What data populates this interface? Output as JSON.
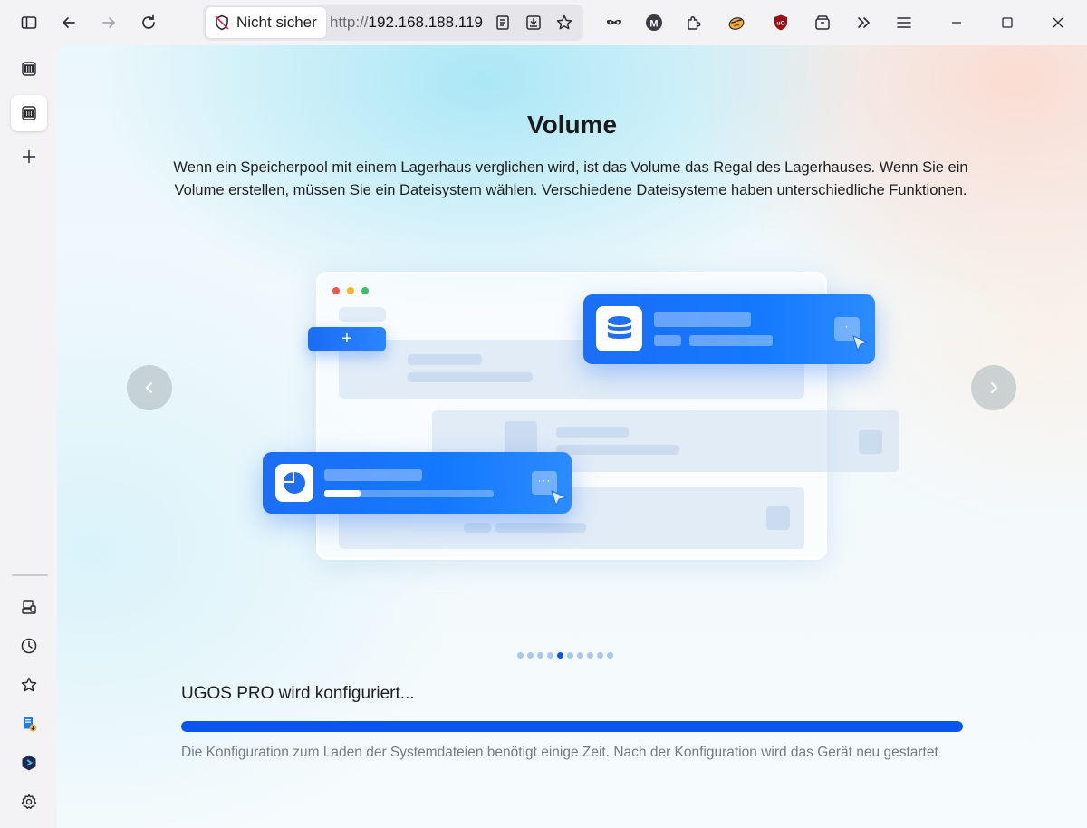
{
  "browser": {
    "security_label": "Nicht sicher",
    "url_protocol": "http://",
    "url_host": "192.168.188.119"
  },
  "icons": {
    "toolbar_left": [
      "sidebar-toggle-icon",
      "back-arrow-icon",
      "forward-arrow-icon",
      "reload-icon"
    ],
    "url_actions": [
      "reader-view-icon",
      "save-page-icon",
      "bookmark-star-icon"
    ],
    "extensions": [
      "mask-extension-icon",
      "m-extension-icon",
      "puzzle-extensions-icon",
      "face-extension-icon",
      "ublock-icon",
      "container-icon",
      "overflow-chevrons-icon",
      "hamburger-menu-icon"
    ],
    "window": [
      "minimize-icon",
      "maximize-icon",
      "close-icon"
    ],
    "sidebar": [
      "tab-nas-icon",
      "tab-nas-active-icon",
      "new-tab-plus-icon",
      "synced-devices-icon",
      "history-clock-icon",
      "bookmarks-star-icon",
      "downloads-icon",
      "app-hexagon-icon",
      "settings-gear-icon"
    ]
  },
  "page": {
    "title": "Volume",
    "description": "Wenn ein Speicherpool mit einem Lagerhaus verglichen wird, ist das Volume das Regal des Lagerhauses. Wenn Sie ein Volume erstellen, müssen Sie ein Dateisystem wählen. Verschiedene Dateisysteme haben unterschiedliche Funktionen.",
    "slides_total": 10,
    "slide_active_index": 4,
    "status": "UGOS PRO wird konfiguriert...",
    "progress_fraction": 1.0,
    "note": "Die Konfiguration zum Laden der Systemdateien benötigt einige Zeit. Nach der Konfiguration wird das Gerät neu gestartet",
    "plus_symbol": "+",
    "more_symbol": "···"
  },
  "colors": {
    "accent": "#0a55f0",
    "card_blue": "#1479ff",
    "pager_inactive": "#a9c8f0",
    "pager_active": "#1357d8"
  }
}
